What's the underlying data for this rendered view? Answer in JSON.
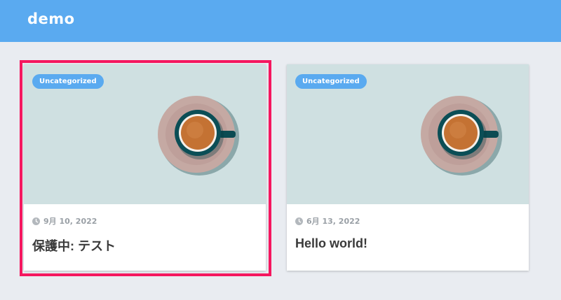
{
  "site": {
    "title": "demo"
  },
  "posts": [
    {
      "category": "Uncategorized",
      "date": "9月 10, 2022",
      "title": "保護中: テスト"
    },
    {
      "category": "Uncategorized",
      "date": "6月 13, 2022",
      "title": "Hello world!"
    }
  ],
  "colors": {
    "header": "#5aaaf0",
    "background": "#e9ecf1",
    "badge": "#5aaaf0",
    "highlight": "#f5175f"
  }
}
